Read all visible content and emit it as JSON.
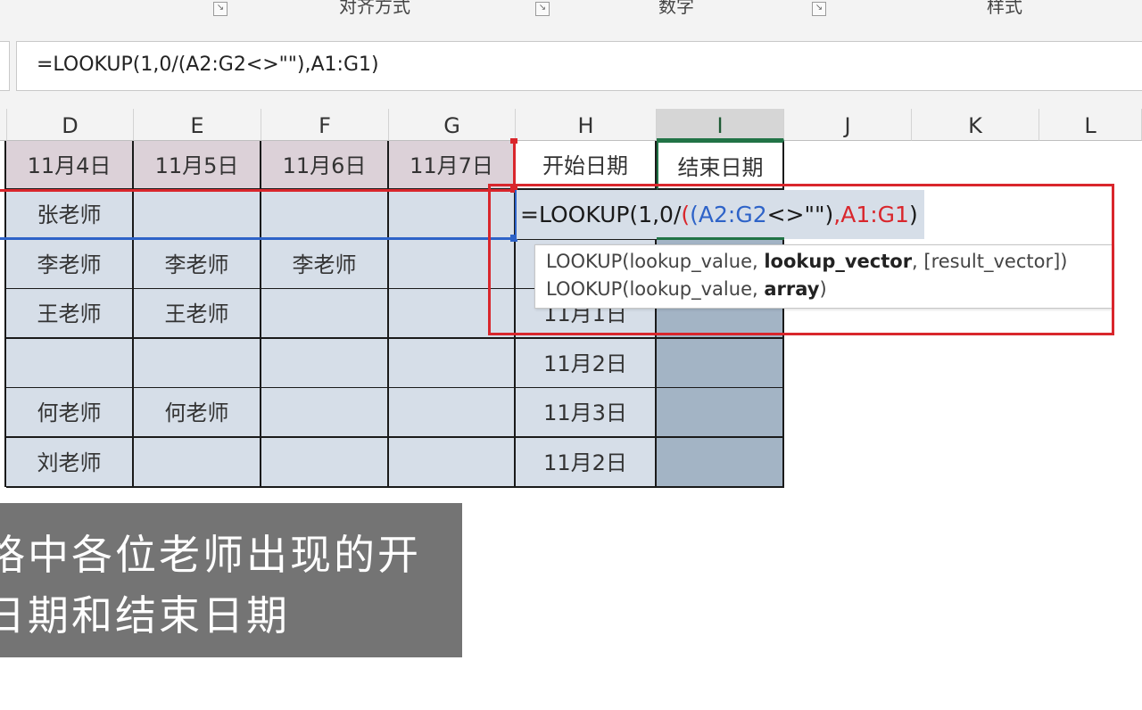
{
  "ribbon": {
    "groups": [
      "对齐方式",
      "数字",
      "样式"
    ]
  },
  "formula_bar": {
    "value": "=LOOKUP(1,0/(A2:G2<>\"\"),A1:G1)"
  },
  "sheet": {
    "columns": [
      "D",
      "E",
      "F",
      "G",
      "H",
      "I",
      "J",
      "K",
      "L"
    ],
    "selected_column": "I",
    "header_row": [
      "11月4日",
      "11月5日",
      "11月6日",
      "11月7日",
      "开始日期",
      "结束日期"
    ],
    "rows": [
      [
        "张老师",
        "",
        "",
        "",
        "",
        ""
      ],
      [
        "李老师",
        "李老师",
        "李老师",
        "",
        "",
        ""
      ],
      [
        "王老师",
        "王老师",
        "",
        "",
        "11月1日",
        ""
      ],
      [
        "",
        "",
        "",
        "",
        "11月2日",
        ""
      ],
      [
        "何老师",
        "何老师",
        "",
        "",
        "11月3日",
        ""
      ],
      [
        "刘老师",
        "",
        "",
        "",
        "11月2日",
        ""
      ]
    ]
  },
  "editing_cell": {
    "eq": "=LOOKUP(1,0/",
    "ref1": "(A2:G2",
    "mid": "<>\"\")",
    "comma": ",",
    "ref2": "A1:G1",
    "close": ")"
  },
  "tooltip": {
    "line1_fn": "LOOKUP(lookup_value, ",
    "line1_bold": "lookup_vector",
    "line1_rest": ", [result_vector])",
    "line2_fn": "LOOKUP(lookup_value, ",
    "line2_bold": "array",
    "line2_rest": ")"
  },
  "caption": {
    "line1": "格中各位老师出现的开",
    "line2": "日期和结束日期"
  },
  "colors": {
    "red_ref": "#d9262c",
    "blue_ref": "#2e63c8",
    "header_row_fill": "#dcd1d8",
    "data_fill": "#d6dee8",
    "end_col_fill": "#a3b4c5"
  }
}
